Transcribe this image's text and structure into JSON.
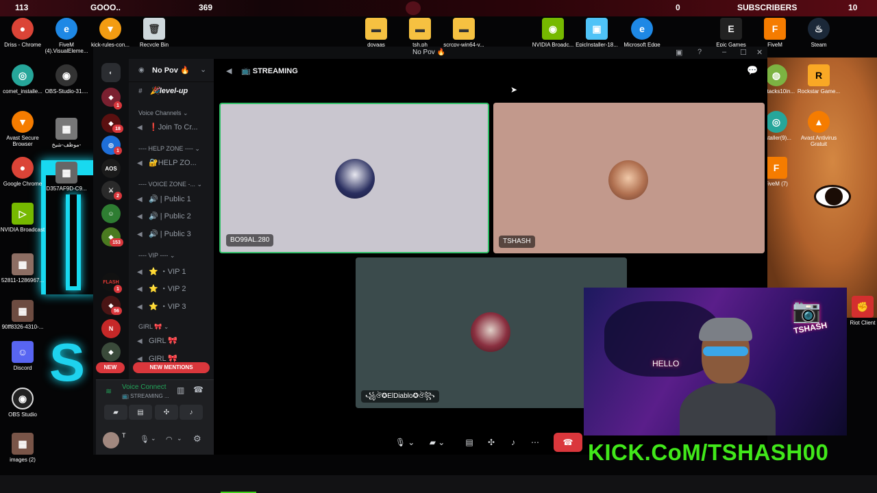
{
  "overlay": {
    "stat_left": "113",
    "goal_label": "GOOO..",
    "goal_value": "369",
    "sub_count": "0",
    "subscribers_label": "SUBSCRIBERS",
    "sub_goal": "10"
  },
  "desktop": {
    "top_icons": [
      "Driss - Chrome",
      "FiveM (4).VisualEleme...",
      "kick-rules-con...",
      "Recycle Bin",
      "dovaas",
      "tsh.ph",
      "scrcpy-win64-v...",
      "NVIDIA Broadc...",
      "EpicInstaller-18...",
      "Microsoft Edge",
      "Epic Games",
      "FiveM",
      "Steam"
    ],
    "left_icons": [
      "comet_installe...",
      "OBS-Studio-31....",
      "Avast Secure Browser",
      "موظف-شيخ-",
      "Google Chrome",
      "D357AF9D-C9...",
      "NVIDIA Broadcast",
      "52811-1286967...",
      "90ff8326-4310-...",
      "Discord",
      "OBS Studio",
      "images (2)"
    ],
    "right_icons": [
      "Ssetacks10in...",
      "Rockstar Game...",
      "installer(9)...",
      "Avast Antivirus Gratuit",
      "FiveM (7)",
      "Riot Client"
    ]
  },
  "discord": {
    "window_title": "No Pov 🔥",
    "server_name": "No Pov 🔥",
    "text_channel": "🎉level-up",
    "categories": {
      "voice": "Voice Channels",
      "help": "---- HELP ZONE ----",
      "voice_zone": "---- VOICE ZONE -...",
      "vip": "---- VIP ----",
      "girl": "GIRL 🎀"
    },
    "channels": {
      "join": "❗Join To Cr...",
      "help": "🔐HELP ZO...",
      "public1": "🔊 | Public 1",
      "public2": "🔊 | Public 2",
      "public3": "🔊 | Public 3",
      "vip1": "⭐ ・VIP 1",
      "vip2": "⭐ ・VIP 2",
      "vip3": "⭐ ・VIP 3",
      "girl1": "GIRL 🎀",
      "girl2": "GIRL 🎀"
    },
    "new_label": "NEW",
    "new_mentions": "NEW MENTIONS",
    "voice_connected": "Voice Connect",
    "voice_channel": "📺 STREAMING ...",
    "user_short": "T",
    "stage_channel": "📺 STREAMING",
    "participants": [
      "BO99AL.280",
      "TSHASH",
      "꧁ঔ✪ElDiablo✪ঔ꧂"
    ],
    "guild_badges": [
      "1",
      "18",
      "1",
      "2",
      "153",
      "1",
      "56"
    ]
  },
  "webcam": {
    "brand_name": "TSHASH",
    "sign_text": "HELLO"
  },
  "kick_url": "KICK.CoM/TSHASH00",
  "colors": {
    "accent_red": "#da373c",
    "kick_green": "#41e81a",
    "neon_cyan": "#18d9f0"
  }
}
